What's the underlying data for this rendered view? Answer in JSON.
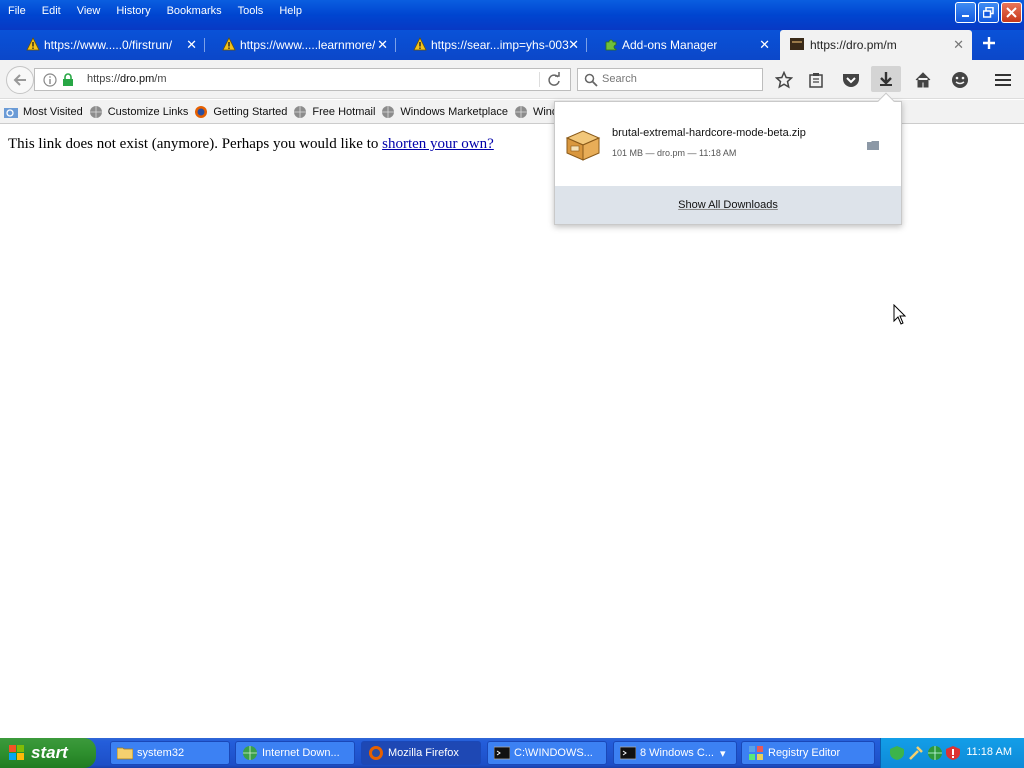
{
  "menu": [
    "File",
    "Edit",
    "View",
    "History",
    "Bookmarks",
    "Tools",
    "Help"
  ],
  "menu_underline": [
    "F",
    "E",
    "V",
    "H",
    "B",
    "T",
    "H"
  ],
  "tabs": [
    {
      "label": "https://www.....0/firstrun/",
      "icon": "warning-icon"
    },
    {
      "label": "https://www.....learnmore/",
      "icon": "warning-icon"
    },
    {
      "label": "https://sear...imp=yhs-003",
      "icon": "warning-icon"
    },
    {
      "label": "Add-ons Manager",
      "icon": "puzzle-icon"
    },
    {
      "label": "https://dro.pm/m",
      "icon": "site-icon"
    }
  ],
  "urlbar": {
    "scheme": "https://",
    "host": "dro.pm",
    "path": "/m"
  },
  "search": {
    "placeholder": "Search"
  },
  "bookmarks": [
    "Most Visited",
    "Customize Links",
    "Getting Started",
    "Free Hotmail",
    "Windows Marketplace",
    "Wind"
  ],
  "content": {
    "message": "This link does not exist (anymore). Perhaps you would like to ",
    "link": "shorten your own?"
  },
  "downloads": {
    "filename": "brutal-extremal-hardcore-mode-beta.zip",
    "meta": "101 MB — dro.pm — 11:18 AM",
    "show_all": "Show All Downloads"
  },
  "taskbar": {
    "start": "start",
    "tasks": [
      {
        "label": "system32",
        "icon": "folder-icon"
      },
      {
        "label": "Internet Down...",
        "icon": "globe-icon"
      },
      {
        "label": "Mozilla Firefox",
        "icon": "firefox-icon"
      },
      {
        "label": "C:\\WINDOWS...",
        "icon": "cmd-icon"
      },
      {
        "label": "8 Windows C...",
        "icon": "cmd-icon"
      },
      {
        "label": "Registry Editor",
        "icon": "regedit-icon"
      }
    ],
    "clock": "11:18 AM"
  }
}
